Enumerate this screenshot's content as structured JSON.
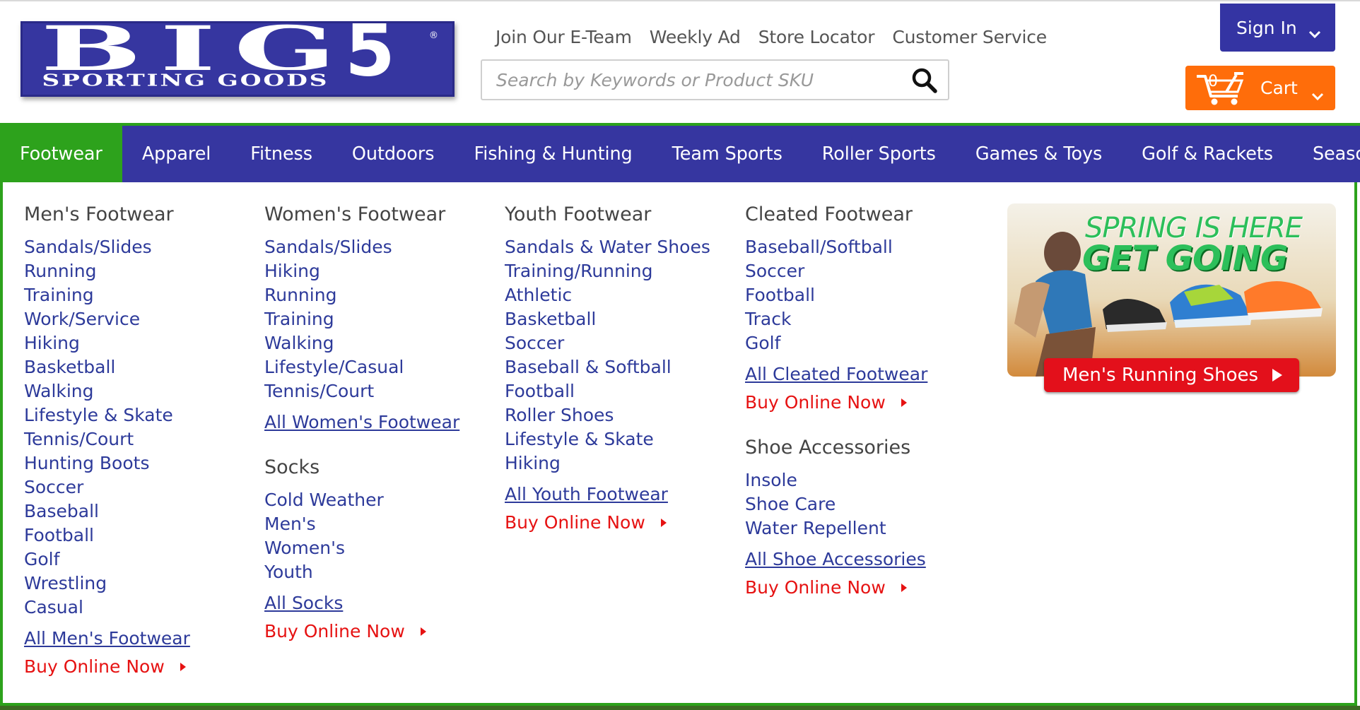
{
  "brand": {
    "logo_line1": "BIG 5",
    "logo_line2": "SPORTING GOODS",
    "registered": "®"
  },
  "header": {
    "links": [
      "Join Our E-Team",
      "Weekly Ad",
      "Store Locator",
      "Customer Service"
    ],
    "search_placeholder": "Search by Keywords or Product SKU",
    "sign_in": "Sign In",
    "cart_label": "Cart",
    "cart_count": "0"
  },
  "colors": {
    "nav_blue": "#3636a0",
    "active_green": "#2da21c",
    "link_blue": "#2d3a9a",
    "buy_red": "#e61212",
    "cart_orange": "#ff6d0a"
  },
  "nav": {
    "items": [
      "Footwear",
      "Apparel",
      "Fitness",
      "Outdoors",
      "Fishing & Hunting",
      "Team Sports",
      "Roller Sports",
      "Games & Toys",
      "Golf & Rackets",
      "Seasonal"
    ],
    "active": "Footwear"
  },
  "menu": {
    "mens": {
      "title": "Men's Footwear",
      "items": [
        "Sandals/Slides",
        "Running",
        "Training",
        "Work/Service",
        "Hiking",
        "Basketball",
        "Walking",
        "Lifestyle & Skate",
        "Tennis/Court",
        "Hunting Boots",
        "Soccer",
        "Baseball",
        "Football",
        "Golf",
        "Wrestling",
        "Casual"
      ],
      "all": "All Men's Footwear",
      "buy": "Buy Online Now"
    },
    "womens": {
      "title": "Women's Footwear",
      "items": [
        "Sandals/Slides",
        "Hiking",
        "Running",
        "Training",
        "Walking",
        "Lifestyle/Casual",
        "Tennis/Court"
      ],
      "all": "All Women's Footwear"
    },
    "socks": {
      "title": "Socks",
      "items": [
        "Cold Weather",
        "Men's",
        "Women's",
        "Youth"
      ],
      "all": "All Socks",
      "buy": "Buy Online Now"
    },
    "youth": {
      "title": "Youth Footwear",
      "items": [
        "Sandals & Water Shoes",
        "Training/Running",
        "Athletic",
        "Basketball",
        "Soccer",
        "Baseball & Softball",
        "Football",
        "Roller Shoes",
        "Lifestyle & Skate",
        "Hiking"
      ],
      "all": "All Youth Footwear",
      "buy": "Buy Online Now"
    },
    "cleated": {
      "title": "Cleated Footwear",
      "items": [
        "Baseball/Softball",
        "Soccer",
        "Football",
        "Track",
        "Golf"
      ],
      "all": "All Cleated Footwear",
      "buy": "Buy Online Now"
    },
    "accessories": {
      "title": "Shoe Accessories",
      "items": [
        "Insole",
        "Shoe Care",
        "Water Repellent"
      ],
      "all": "All Shoe Accessories",
      "buy": "Buy Online Now"
    }
  },
  "promo": {
    "line1": "SPRING IS HERE",
    "line2": "GET GOING",
    "cta": "Men's Running Shoes"
  }
}
